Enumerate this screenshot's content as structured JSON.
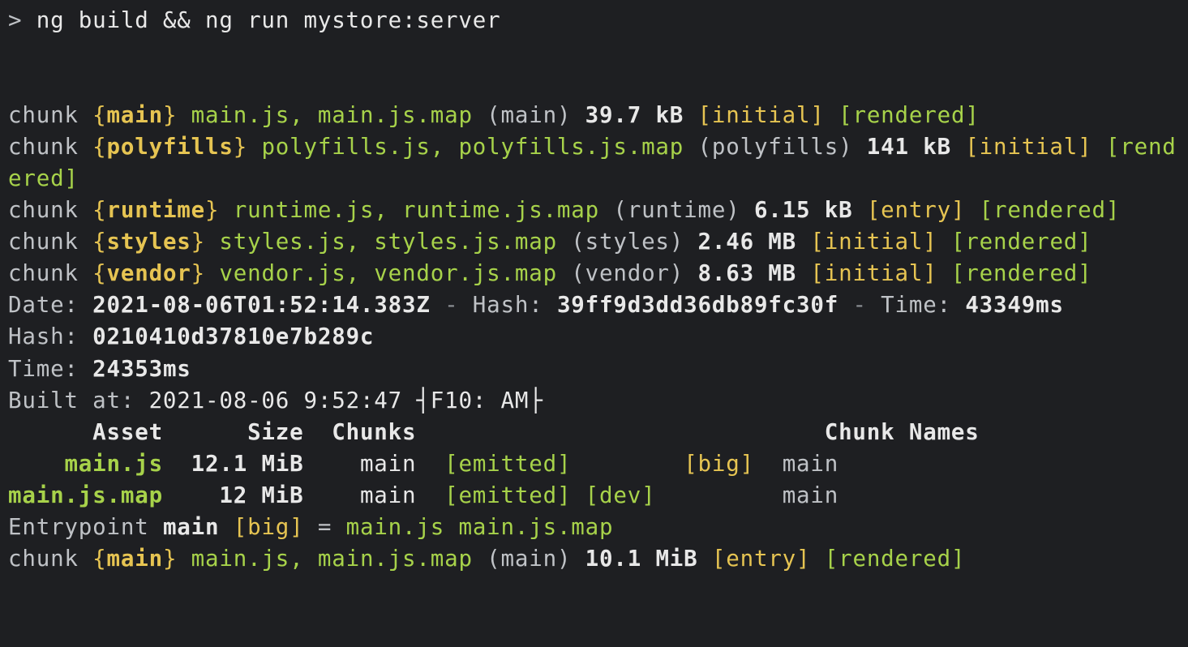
{
  "prompt": {
    "caret": ">",
    "command": "ng build && ng run mystore:server"
  },
  "word": {
    "chunk": "chunk",
    "date": "Date:",
    "hash": "Hash:",
    "time": "Time:",
    "built_at": "Built at:",
    "entrypoint": "Entrypoint",
    "equals": "=",
    "sep": " - "
  },
  "chunks1": [
    {
      "name": "main",
      "files": "main.js, main.js.map",
      "paren": "(main)",
      "size": "39.7 kB",
      "tag1": "[initial]",
      "tag2": "[rendered]"
    },
    {
      "name": "polyfills",
      "files": "polyfills.js, polyfills.js.map",
      "paren": "(polyfills)",
      "size": "141 kB",
      "tag1": "[initial]",
      "tag2": "[rendered]"
    },
    {
      "name": "runtime",
      "files": "runtime.js, runtime.js.map",
      "paren": "(runtime)",
      "size": "6.15 kB",
      "tag1": "[entry]",
      "tag2": "[rendered]"
    },
    {
      "name": "styles",
      "files": "styles.js, styles.js.map",
      "paren": "(styles)",
      "size": "2.46 MB",
      "tag1": "[initial]",
      "tag2": "[rendered]"
    },
    {
      "name": "vendor",
      "files": "vendor.js, vendor.js.map",
      "paren": "(vendor)",
      "size": "8.63 MB",
      "tag1": "[initial]",
      "tag2": "[rendered]"
    }
  ],
  "meta1": {
    "date": "2021-08-06T01:52:14.383Z",
    "hash": "39ff9d3dd36db89fc30f",
    "time": "43349ms"
  },
  "meta2": {
    "hash": "0210410d37810e7b289c",
    "time": "24353ms",
    "built_at_date": "2021-08-06",
    "built_at_time": "9:52:47",
    "built_at_suffix": "┤F10: AM├"
  },
  "table": {
    "header": {
      "asset": "Asset",
      "size": "Size",
      "chunks": "Chunks",
      "chunk_names": "Chunk Names"
    },
    "rows": [
      {
        "asset": "main.js",
        "size": "12.1 MiB",
        "chunk": "main",
        "flag1": "[emitted]",
        "flag2": "",
        "extra": "[big]",
        "name": "main"
      },
      {
        "asset": "main.js.map",
        "size": "12 MiB",
        "chunk": "main",
        "flag1": "[emitted]",
        "flag2": "[dev]",
        "extra": "",
        "name": "main"
      }
    ]
  },
  "entrypoint": {
    "name": "main",
    "tag": "[big]",
    "files": "main.js main.js.map"
  },
  "chunk2": {
    "name": "main",
    "files": "main.js, main.js.map",
    "paren": "(main)",
    "size": "10.1 MiB",
    "tag1": "[entry]",
    "tag2": "[rendered]"
  }
}
